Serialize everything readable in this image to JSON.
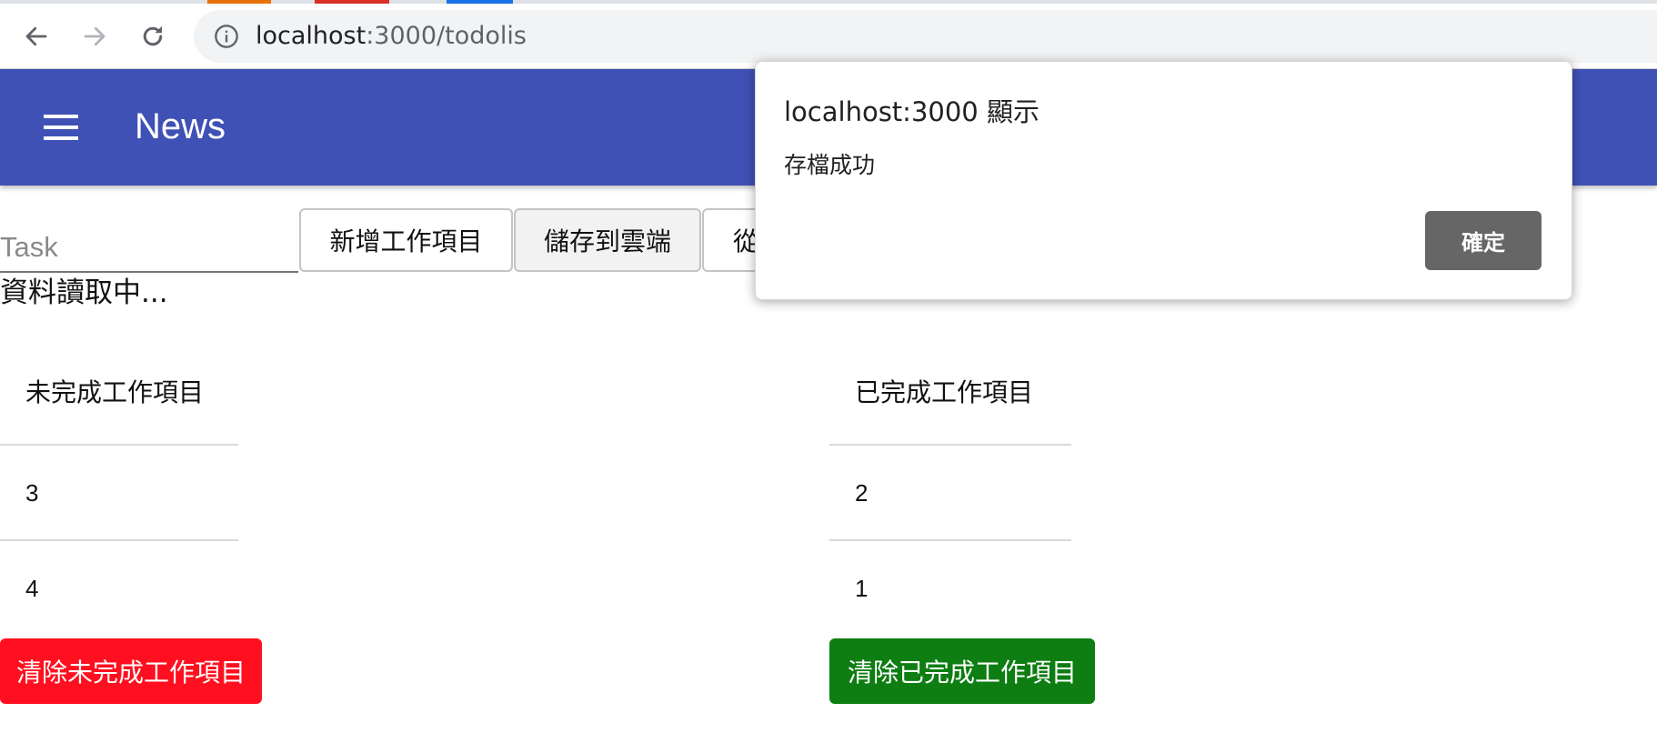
{
  "browser": {
    "url_host": "localhost",
    "url_rest": ":3000/todolis",
    "back_icon": "arrow-left-icon",
    "forward_icon": "arrow-right-icon",
    "reload_icon": "reload-icon",
    "info_icon": "info-icon",
    "tab_colors": [
      "#e8710a",
      "#d93025",
      "#1a73e8"
    ]
  },
  "appbar": {
    "menu_icon": "hamburger-menu-icon",
    "title": "News",
    "color": "#3f51b5"
  },
  "toolbar": {
    "task_placeholder": "Task",
    "task_value": "",
    "add_label": "新增工作項目",
    "save_label": "儲存到雲端",
    "load_label_partial": "從"
  },
  "loading_text": "資料讀取中...",
  "incomplete": {
    "header": "未完成工作項目",
    "items": [
      "3",
      "4"
    ],
    "clear_label": "清除未完成工作項目",
    "clear_color": "#ff0f1f"
  },
  "completed": {
    "header": "已完成工作項目",
    "items": [
      "2",
      "1"
    ],
    "clear_label": "清除已完成工作項目",
    "clear_color": "#0e7d12"
  },
  "dialog": {
    "title": "localhost:3000 顯示",
    "message": "存檔成功",
    "ok_label": "確定"
  }
}
